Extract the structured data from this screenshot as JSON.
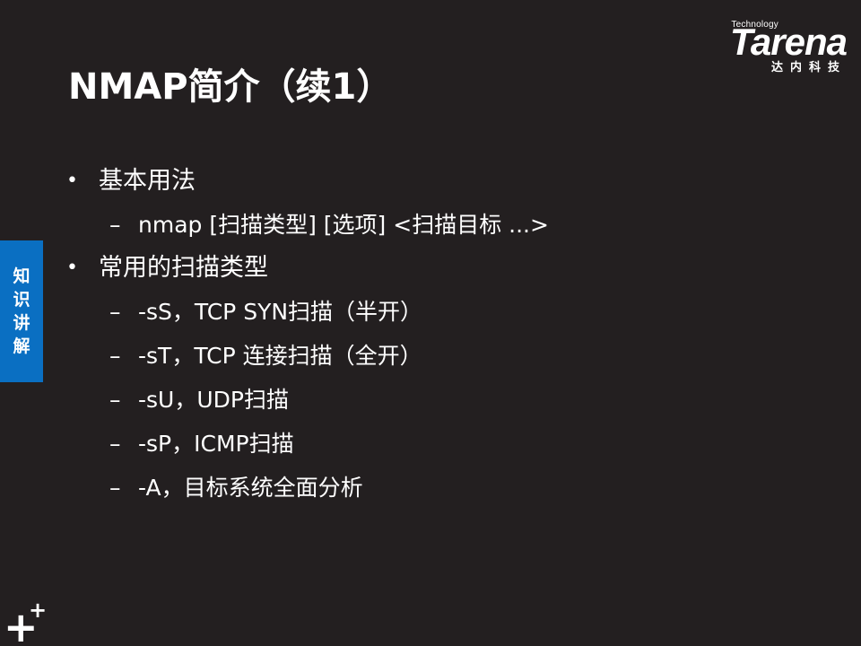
{
  "slide": {
    "title": "NMAP简介（续1）",
    "logo": {
      "tagline": "Technology",
      "brand": "Tarena",
      "chinese": "达内科技"
    },
    "side_tab": [
      "知",
      "识",
      "讲",
      "解"
    ],
    "items": [
      {
        "bullet": "•",
        "text": "基本用法",
        "subs": [
          {
            "dash": "–",
            "text": "nmap  [扫描类型]  [选项]  <扫描目标 ...>"
          }
        ]
      },
      {
        "bullet": "•",
        "text": "常用的扫描类型",
        "subs": [
          {
            "dash": "–",
            "text": "-sS，TCP SYN扫描（半开）"
          },
          {
            "dash": "–",
            "text": "-sT，TCP 连接扫描（全开）"
          },
          {
            "dash": "–",
            "text": "-sU，UDP扫描"
          },
          {
            "dash": "–",
            "text": "-sP，ICMP扫描"
          },
          {
            "dash": "–",
            "text": "-A，目标系统全面分析"
          }
        ]
      }
    ],
    "corner_mark": {
      "big": "+",
      "small": "+"
    }
  }
}
